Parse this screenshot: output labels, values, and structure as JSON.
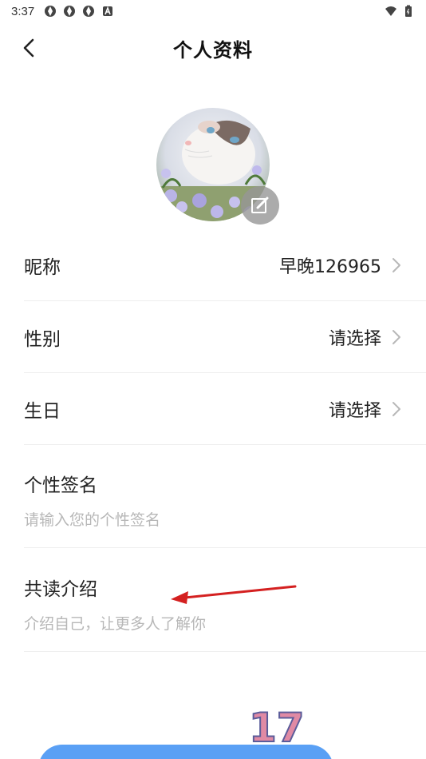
{
  "status_bar": {
    "time": "3:37",
    "left_icons": [
      "aperture-icon",
      "aperture-icon",
      "aperture-icon",
      "a-badge-icon"
    ],
    "right_icons": [
      "wifi-icon",
      "battery-icon"
    ]
  },
  "header": {
    "title": "个人资料",
    "back_icon": "chevron-left-icon"
  },
  "avatar": {
    "description_icon": "avatar-cat-photo",
    "edit_icon": "edit-icon"
  },
  "rows": [
    {
      "label": "昵称",
      "value": "早晚126965",
      "icon": "chevron-right-icon"
    },
    {
      "label": "性别",
      "value": "请选择",
      "icon": "chevron-right-icon"
    },
    {
      "label": "生日",
      "value": "请选择",
      "icon": "chevron-right-icon"
    }
  ],
  "signature": {
    "label": "个性签名",
    "value": "",
    "placeholder": "请输入您的个性签名"
  },
  "intro": {
    "label": "共读介绍",
    "value": "",
    "placeholder": "介绍自己，让更多人了解你"
  },
  "watermark": {
    "text": "17"
  },
  "colors": {
    "accent": "#5aa0f5",
    "divider": "#eeeeee",
    "placeholder": "#b7b7b7",
    "arrow": "#d42020"
  }
}
